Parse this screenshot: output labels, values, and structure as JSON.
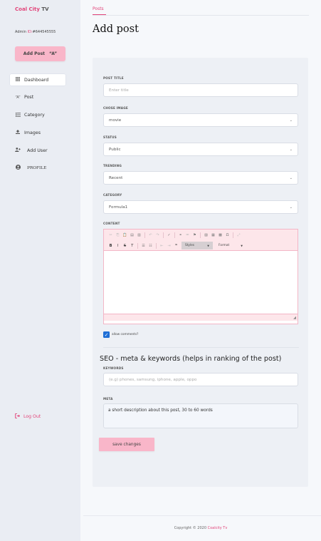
{
  "sidebar": {
    "brand_part1": "Coal City",
    "brand_part2": "TV",
    "admin_id_prefix": "Admin",
    "admin_id_label": "ID:",
    "admin_id_value": "#644545555",
    "add_post_label": "Add Post",
    "add_post_icon": "\"A\"",
    "nav": [
      {
        "label": "Dashboard",
        "icon": "grid-icon",
        "glyph": "⠿",
        "active": true
      },
      {
        "label": "Post",
        "icon": "quote-icon",
        "glyph": "“A”"
      },
      {
        "label": "Category",
        "icon": "list-icon",
        "glyph": "☷"
      },
      {
        "label": "Images",
        "icon": "upload-icon",
        "glyph": "⇪"
      },
      {
        "label": "Add User",
        "icon": "user-plus-icon",
        "glyph": "👤"
      },
      {
        "label": "PROFILE",
        "icon": "user-circle-icon",
        "glyph": "●"
      }
    ],
    "logout_label": "Log Out"
  },
  "main": {
    "breadcrumb": "Posts",
    "title": "Add post"
  },
  "form": {
    "post_title_label": "POST TITLE",
    "post_title_placeholder": "Enter title",
    "image_label": "CHOSE IMAGE",
    "image_value": "movie",
    "status_label": "STATUS",
    "status_value": "Public",
    "trending_label": "TRENDING",
    "trending_value": "Recent",
    "category_label": "CATEGORY",
    "category_value": "Formula1",
    "content_label": "CONTENT",
    "styles_label": "Styles",
    "format_label": "Format",
    "allow_comments_label": "allow comments?",
    "allow_comments_checked": true,
    "seo_title": "SEO - meta & keywords (helps in ranking of the post)",
    "keywords_label": "KEYWORDS",
    "keywords_placeholder": "(e.g) phones, samsung, iphone, apple, oppo",
    "meta_label": "META",
    "meta_value": "a short description about this post,  30 to 60 words",
    "save_label": "save changes"
  },
  "footer": {
    "copyright": "Copyright © 2020",
    "brand": "Coalcity Tv"
  },
  "colors": {
    "accent": "#e2457a",
    "button_pink": "#f9b6c9",
    "editor_pink": "#fde6ea",
    "checkbox_blue": "#1f6fd6"
  }
}
